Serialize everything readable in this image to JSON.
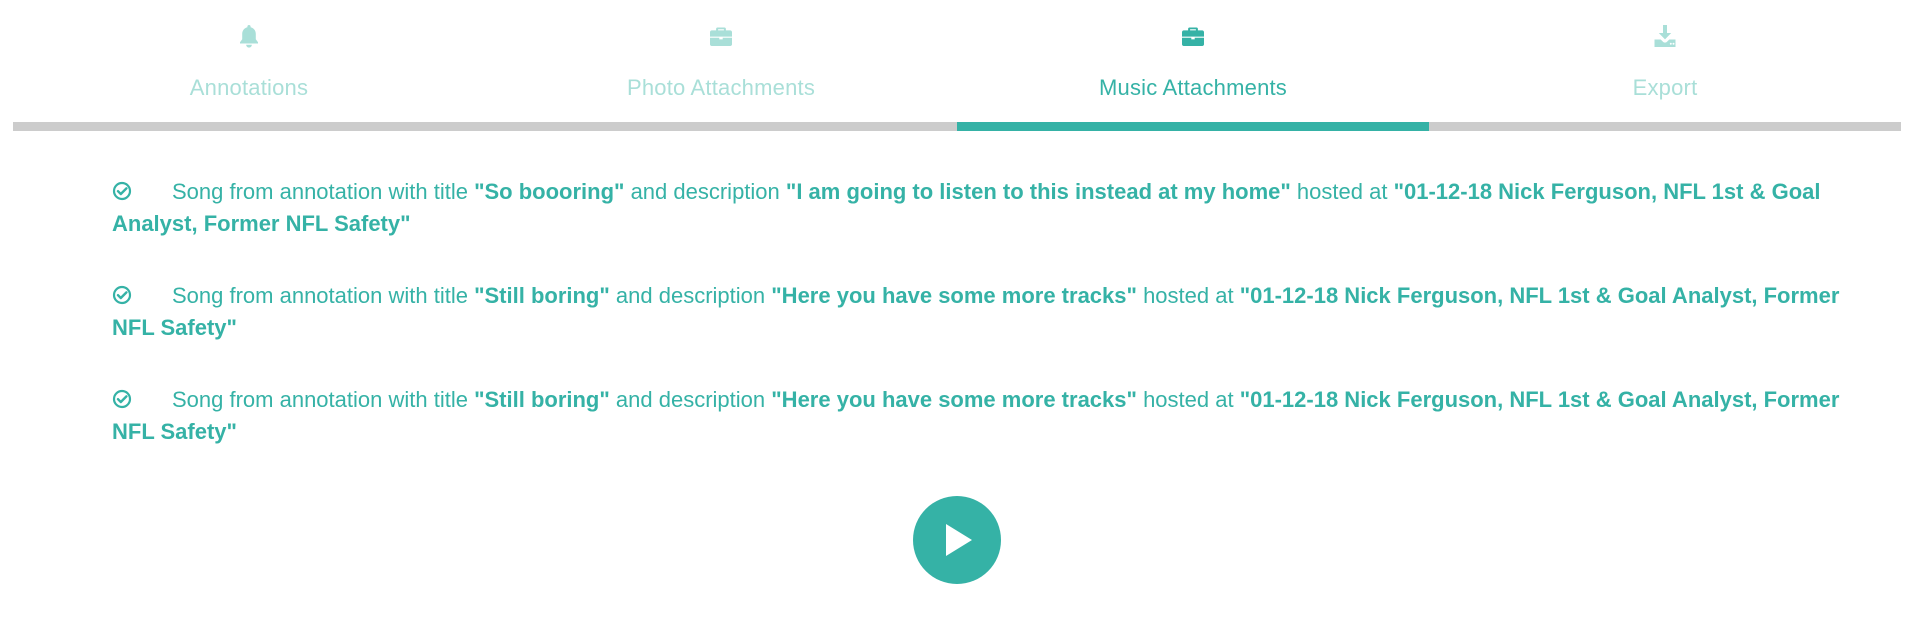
{
  "tabs": [
    {
      "label": "Annotations",
      "icon": "bell-icon",
      "active": false
    },
    {
      "label": "Photo Attachments",
      "icon": "briefcase-icon",
      "active": false
    },
    {
      "label": "Music Attachments",
      "icon": "briefcase-icon",
      "active": true
    },
    {
      "label": "Export",
      "icon": "download-icon",
      "active": false
    }
  ],
  "colors": {
    "accent": "#35b2a6",
    "accent_light": "#a9dfd8",
    "track": "#cccccc"
  },
  "songs": [
    {
      "prefix": "Song from annotation with title ",
      "title": "\"So boooring\"",
      "mid1": " and description ",
      "description": "\"I am going to listen to this instead at my home\"",
      "mid2": " hosted at ",
      "host": "\"01-12-18 Nick Ferguson, NFL 1st & Goal Analyst, Former NFL Safety\""
    },
    {
      "prefix": "Song from annotation with title ",
      "title": "\"Still boring\"",
      "mid1": " and description ",
      "description": "\"Here you have some more tracks\"",
      "mid2": " hosted at ",
      "host": "\"01-12-18 Nick Ferguson, NFL 1st & Goal Analyst, Former NFL Safety\""
    },
    {
      "prefix": "Song from annotation with title ",
      "title": "\"Still boring\"",
      "mid1": " and description ",
      "description": "\"Here you have some more tracks\"",
      "mid2": " hosted at ",
      "host": "\"01-12-18 Nick Ferguson, NFL 1st & Goal Analyst, Former NFL Safety\""
    }
  ],
  "player": {
    "icon": "play-icon"
  }
}
